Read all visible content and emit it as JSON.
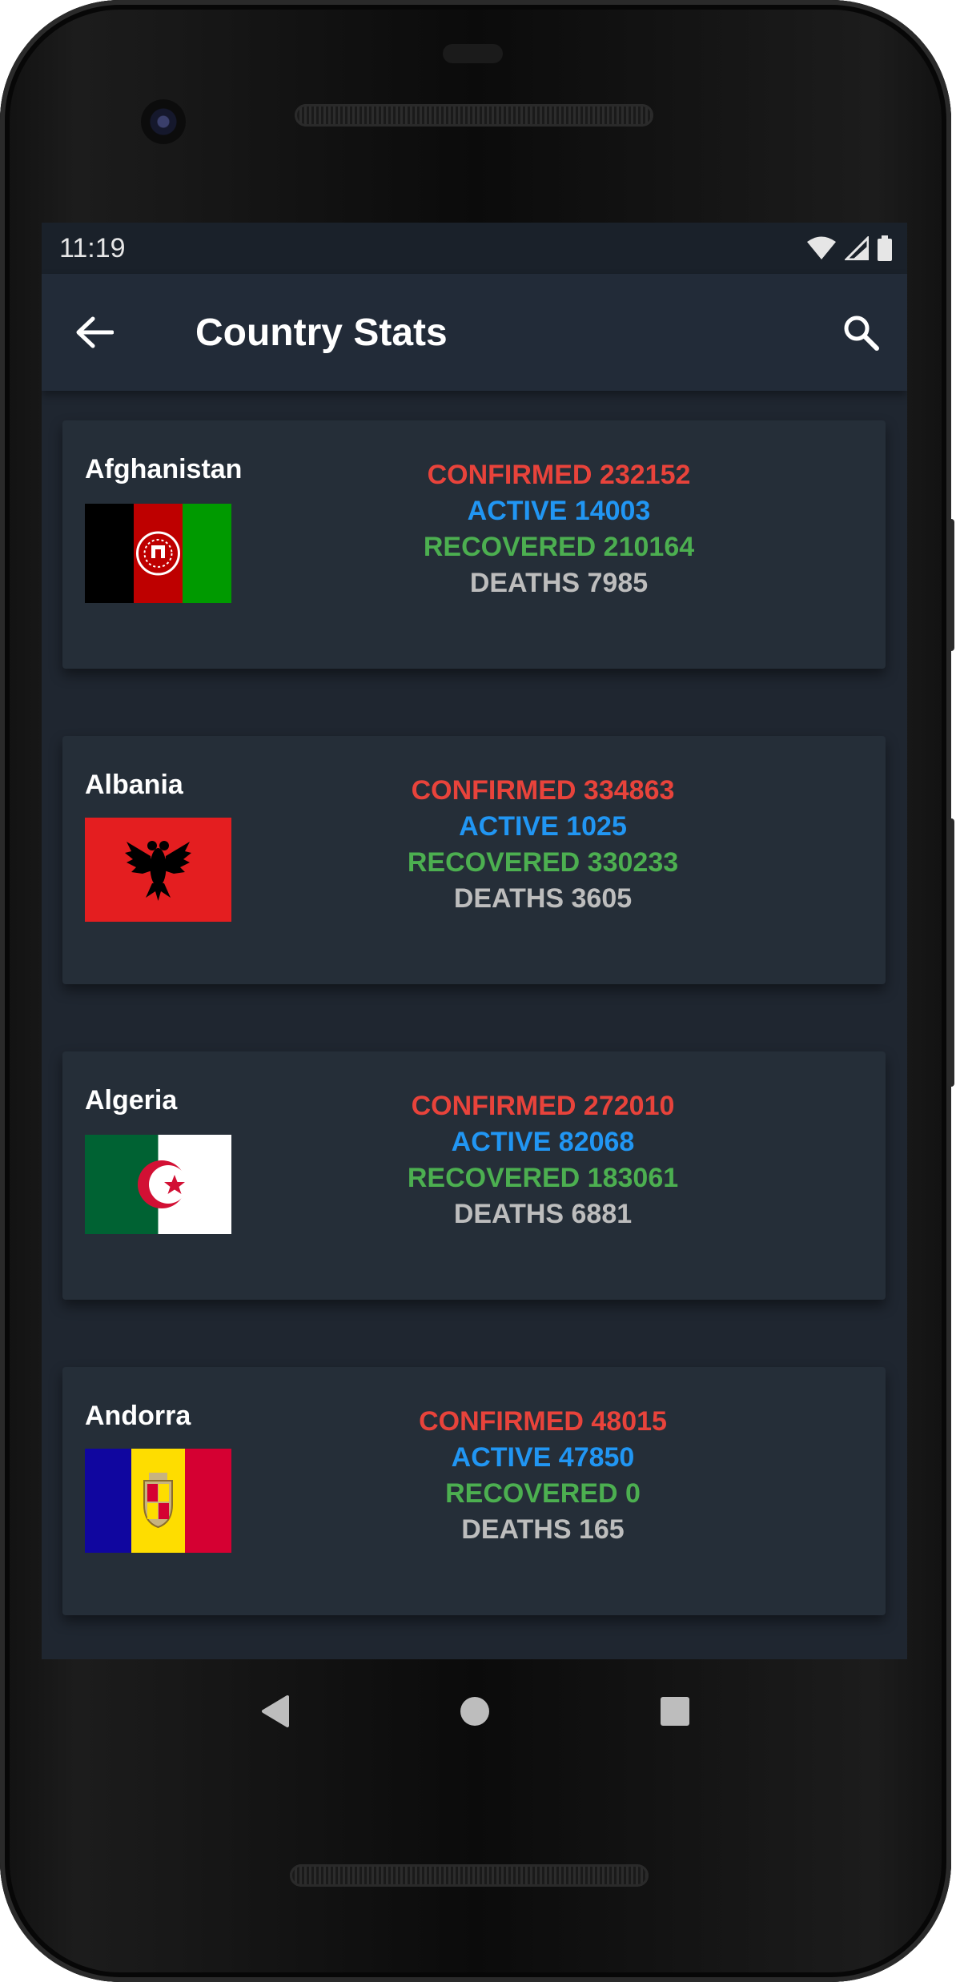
{
  "status_bar": {
    "time": "11:19"
  },
  "app_bar": {
    "title": "Country Stats"
  },
  "colors": {
    "confirmed": "#e8433b",
    "active": "#2196f3",
    "recovered": "#4caf50",
    "deaths": "#bdbdbd"
  },
  "countries": [
    {
      "name": "Afghanistan",
      "flag_icon": "afghanistan-flag",
      "confirmed": "CONFIRMED 232152",
      "active": "ACTIVE 14003",
      "recovered": "RECOVERED 210164",
      "deaths": "DEATHS 7985"
    },
    {
      "name": "Albania",
      "flag_icon": "albania-flag",
      "confirmed": "CONFIRMED 334863",
      "active": "ACTIVE 1025",
      "recovered": "RECOVERED 330233",
      "deaths": "DEATHS 3605"
    },
    {
      "name": "Algeria",
      "flag_icon": "algeria-flag",
      "confirmed": "CONFIRMED 272010",
      "active": "ACTIVE 82068",
      "recovered": "RECOVERED 183061",
      "deaths": "DEATHS 6881"
    },
    {
      "name": "Andorra",
      "flag_icon": "andorra-flag",
      "confirmed": "CONFIRMED 48015",
      "active": "ACTIVE 47850",
      "recovered": "RECOVERED 0",
      "deaths": "DEATHS 165"
    }
  ]
}
